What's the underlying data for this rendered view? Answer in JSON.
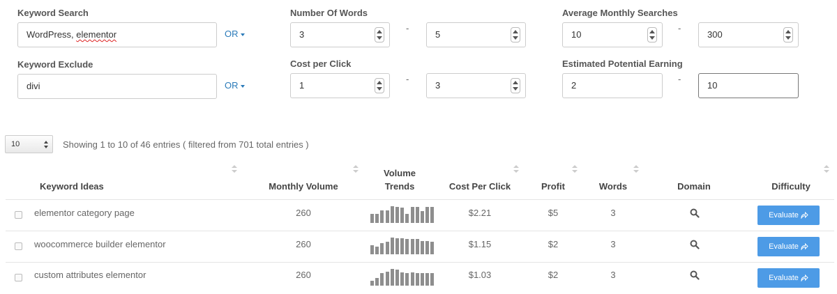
{
  "filters": {
    "keyword_search": {
      "label": "Keyword Search",
      "value": "WordPress, elementor",
      "value_plain": "WordPress, ",
      "value_misspelled": "elementor",
      "operator": "OR"
    },
    "keyword_exclude": {
      "label": "Keyword Exclude",
      "value": "divi",
      "operator": "OR"
    },
    "number_of_words": {
      "label": "Number Of Words",
      "min": "3",
      "max": "5"
    },
    "cost_per_click": {
      "label": "Cost per Click",
      "min": "1",
      "max": "3"
    },
    "avg_monthly_searches": {
      "label": "Average Monthly Searches",
      "min": "10",
      "max": "300"
    },
    "estimated_potential_earning": {
      "label": "Estimated Potential Earning",
      "min": "2",
      "max": "10"
    },
    "range_separator": "-"
  },
  "table_controls": {
    "page_length": "10",
    "info": "Showing 1 to 10 of 46 entries ( filtered from 701 total entries )"
  },
  "columns": {
    "keyword_ideas": "Keyword Ideas",
    "monthly_volume": "Monthly Volume",
    "volume_trends_line1": "Volume",
    "volume_trends_line2": "Trends",
    "cost_per_click": "Cost Per Click",
    "profit": "Profit",
    "words": "Words",
    "domain": "Domain",
    "difficulty": "Difficulty"
  },
  "rows": [
    {
      "keyword": "elementor category page",
      "volume": "260",
      "trend": [
        0.55,
        0.55,
        0.75,
        0.75,
        1.0,
        0.95,
        0.9,
        0.55,
        0.95,
        0.95,
        0.7,
        0.95,
        0.95
      ],
      "cpc": "$2.21",
      "profit": "$5",
      "words": "3",
      "evaluate": "Evaluate"
    },
    {
      "keyword": "woocommerce builder elementor",
      "volume": "260",
      "trend": [
        0.55,
        0.45,
        0.65,
        0.75,
        1.0,
        0.95,
        0.95,
        0.9,
        0.9,
        0.9,
        0.8,
        0.8,
        0.75
      ],
      "cpc": "$1.15",
      "profit": "$2",
      "words": "3",
      "evaluate": "Evaluate"
    },
    {
      "keyword": "custom attributes elementor",
      "volume": "260",
      "trend": [
        0.3,
        0.45,
        0.75,
        0.85,
        1.0,
        0.95,
        0.8,
        0.75,
        0.8,
        0.75,
        0.75,
        0.75,
        0.75
      ],
      "cpc": "$1.03",
      "profit": "$2",
      "words": "3",
      "evaluate": "Evaluate"
    }
  ],
  "colors": {
    "accent_link": "#2a7ab9",
    "button": "#4d9be6",
    "trend_bar": "#8e8e8e"
  },
  "icons": {
    "domain": "search-icon",
    "evaluate": "share-arrow-icon",
    "sort": "sort-arrows-icon"
  }
}
